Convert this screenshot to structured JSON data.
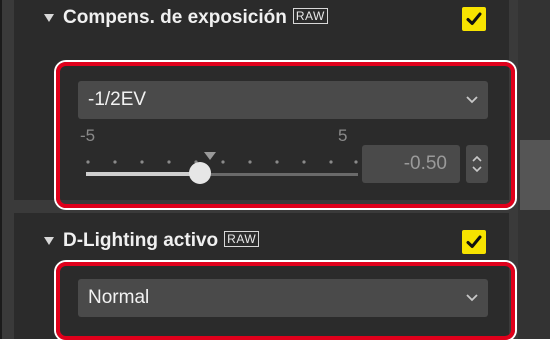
{
  "exposure": {
    "title": "Compens. de exposición",
    "raw_badge": "RAW",
    "checked": true,
    "dropdown_value": "-1/2EV",
    "slider_min_label": "-5",
    "slider_max_label": "5",
    "slider_value": -0.5,
    "numeric_value": "-0.50"
  },
  "dlighting": {
    "title": "D-Lighting activo",
    "raw_badge": "RAW",
    "checked": true,
    "dropdown_value": "Normal"
  },
  "colors": {
    "checkbox": "#f7e300",
    "highlight": "#e0001b",
    "panel": "#2b2b2b",
    "control": "#4a4a4a"
  }
}
